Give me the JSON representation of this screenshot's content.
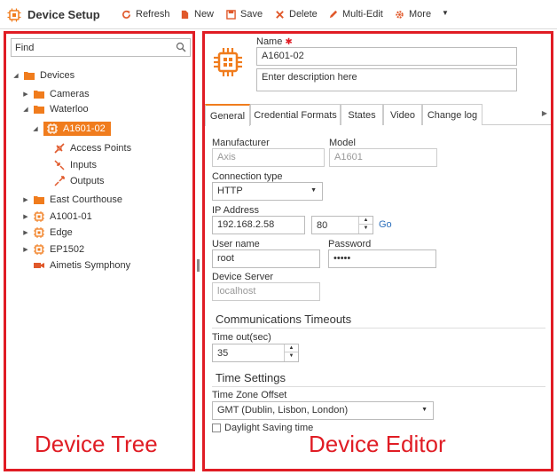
{
  "toolbar": {
    "title": "Device Setup",
    "refresh": "Refresh",
    "new": "New",
    "save": "Save",
    "delete": "Delete",
    "multi_edit": "Multi-Edit",
    "more": "More",
    "overflow_icon": "caret-down-icon"
  },
  "tree": {
    "find_placeholder": "Find",
    "nodes": {
      "devices": "Devices",
      "cameras": "Cameras",
      "waterloo": "Waterloo",
      "a1601_02": "A1601-02",
      "access_points": "Access Points",
      "inputs": "Inputs",
      "outputs": "Outputs",
      "east_courthouse": "East Courthouse",
      "a1001_01": "A1001-01",
      "edge": "Edge",
      "ep1502": "EP1502",
      "aimetis_symphony": "Aimetis Symphony"
    },
    "annotation": "Device Tree"
  },
  "editor": {
    "name_label": "Name",
    "name_value": "A1601-02",
    "description_placeholder": "Enter description here",
    "tabs": [
      "General",
      "Credential Formats",
      "States",
      "Video",
      "Change log"
    ],
    "active_tab": "General",
    "manufacturer_label": "Manufacturer",
    "manufacturer_value": "Axis",
    "model_label": "Model",
    "model_value": "A1601",
    "connection_type_label": "Connection type",
    "connection_type_value": "HTTP",
    "ip_address_label": "IP Address",
    "ip_address_value": "192.168.2.58",
    "port_value": "80",
    "go_label": "Go",
    "username_label": "User name",
    "username_value": "root",
    "password_label": "Password",
    "password_value": "•••••",
    "device_server_label": "Device Server",
    "device_server_value": "localhost",
    "comm_timeouts_title": "Communications Timeouts",
    "timeout_label": "Time out(sec)",
    "timeout_value": "35",
    "time_settings_title": "Time Settings",
    "timezone_label": "Time Zone Offset",
    "timezone_value": "GMT (Dublin, Lisbon, London)",
    "dst_label": "Daylight Saving time",
    "dst_checked": false,
    "annotation": "Device Editor"
  },
  "colors": {
    "accent": "#f07c1d",
    "annotation_red": "#e01c24",
    "link": "#2a6ebb"
  }
}
